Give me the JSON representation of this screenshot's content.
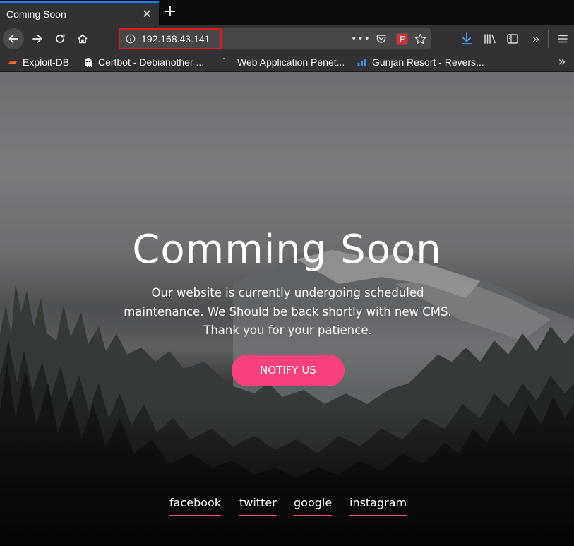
{
  "tab": {
    "title": "Coming Soon"
  },
  "urlbar": {
    "url": "192.168.43.141"
  },
  "bookmarks": [
    {
      "label": "Exploit-DB",
      "icon": "exploit-db-icon"
    },
    {
      "label": "Certbot - Debianother ...",
      "icon": "certbot-icon"
    },
    {
      "label": "Web Application Penet...",
      "icon": "web-page-icon"
    },
    {
      "label": "Gunjan Resort - Revers...",
      "icon": "bar-chart-icon"
    }
  ],
  "hero": {
    "title": "Comming Soon",
    "lines": [
      "Our website is currently undergoing scheduled",
      "maintenance. We Should be back shortly with new CMS.",
      "Thank you for your patience."
    ],
    "button": "NOTIFY US"
  },
  "social": [
    "facebook",
    "twitter",
    "google",
    "instagram"
  ],
  "colors": {
    "accent": "#f8417d",
    "url_highlight": "#e0191b",
    "tab_indicator": "#0a84ff",
    "toolbar": "#323234"
  }
}
